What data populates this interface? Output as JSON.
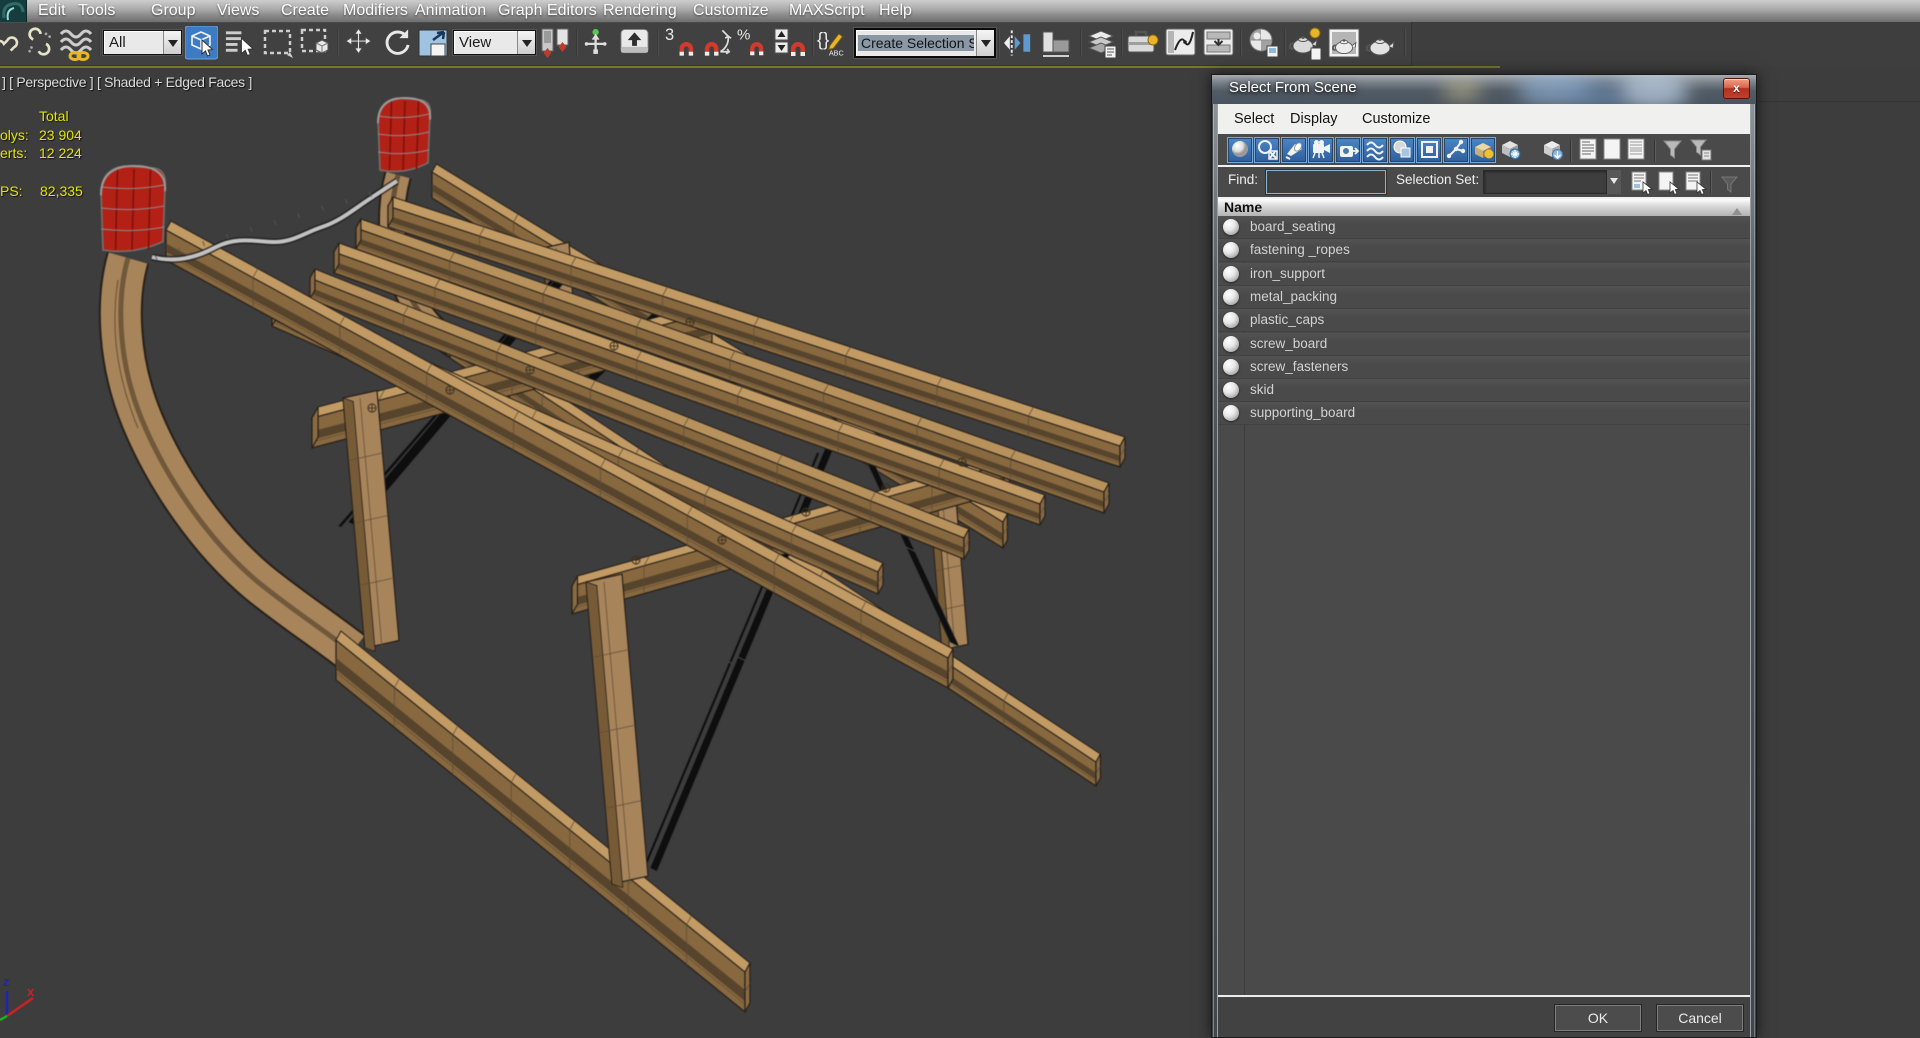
{
  "menu_bar": {
    "items": [
      "Edit",
      "Tools",
      "Group",
      "Views",
      "Create",
      "Modifiers",
      "Animation",
      "Graph Editors",
      "Rendering",
      "Customize",
      "MAXScript",
      "Help"
    ]
  },
  "toolbar": {
    "selection_filter_value": "All",
    "reference_coordinate_system_value": "View",
    "named_selection_set_value": "Create Selection Se",
    "icons": [
      "select-and-link",
      "unlink-selection",
      "bind-to-space-warp",
      "select-object",
      "select-by-name",
      "rectangular-selection-region",
      "window-crossing",
      "select-and-move",
      "select-and-rotate",
      "select-and-scale",
      "use-pivot-point-center",
      "select-and-manipulate",
      "keyboard-shortcut-override",
      "snap-toggle-3d",
      "angle-snap",
      "percent-snap",
      "spinner-snap",
      "edit-named-selection-sets",
      "mirror",
      "align",
      "layer-manager",
      "toolbox",
      "curve-editor",
      "schematic-view",
      "material-editor",
      "render-setup",
      "rendered-frame-window",
      "render-production"
    ]
  },
  "viewport": {
    "label": "] [ Perspective ] [ Shaded + Edged Faces ]",
    "stats": {
      "header": "Total",
      "polys_label": "olys:",
      "polys_value": "23 904",
      "verts_label": "erts:",
      "verts_value": "12 224",
      "fps_label": "PS:",
      "fps_value": "82,335"
    },
    "axis_labels": {
      "x": "x",
      "z": "z"
    }
  },
  "dialog": {
    "title": "Select From Scene",
    "close_label": "x",
    "menu": [
      "Select",
      "Display",
      "Customize"
    ],
    "toolbar_icons": [
      "display-geometry",
      "display-shapes",
      "display-lights",
      "display-cameras",
      "display-helpers",
      "display-space-warps",
      "display-groups",
      "display-xrefs",
      "display-bones",
      "display-containers",
      "display-frozen-objects",
      "display-hidden-objects",
      "list-view",
      "column-view",
      "detail-view",
      "filter",
      "filter-selected"
    ],
    "find_label": "Find:",
    "find_value": "",
    "selection_set_label": "Selection Set:",
    "selection_set_value": "",
    "list": {
      "header": "Name",
      "items": [
        "board_seating",
        "fastening _ropes",
        "iron_support",
        "metal_packing",
        "plastic_caps",
        "screw_board",
        "screw_fasteners",
        "skid",
        "supporting_board"
      ]
    },
    "ok_label": "OK",
    "cancel_label": "Cancel"
  },
  "colors": {
    "viewport_background": "#3d3d3d",
    "toolbar_background": "#414141",
    "active_viewport_border": "#7c762d",
    "stats_text": "#e4e400",
    "dialog_icon_highlight": "#3f74b3",
    "close_button": "#c23a27",
    "wood_top": "#c8a169",
    "wood_side": "#8d6e44",
    "plastic_cap": "#b32016"
  }
}
